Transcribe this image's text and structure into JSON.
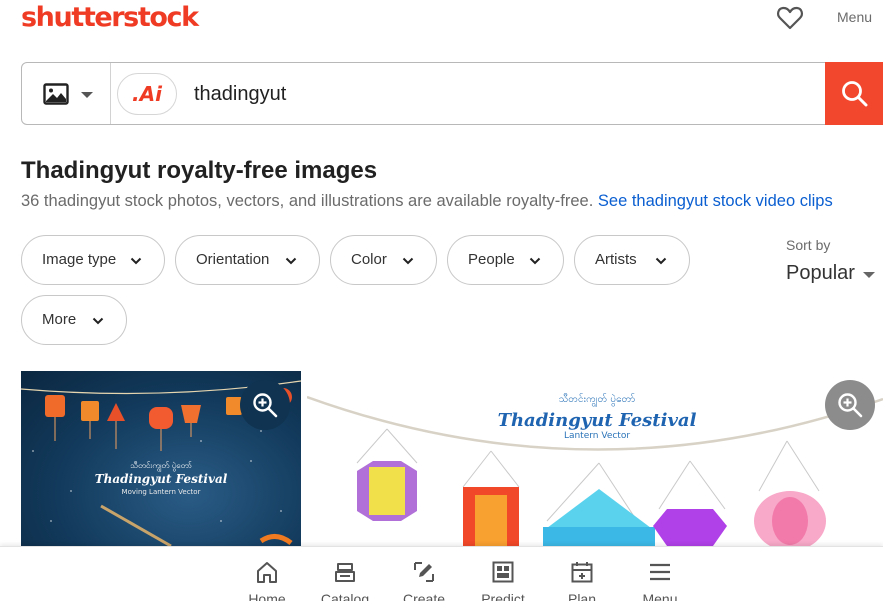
{
  "header": {
    "logo_text": "shutterstock",
    "menu_label": "Menu"
  },
  "search": {
    "ai_badge": ".Ai",
    "query": "thadingyut"
  },
  "results": {
    "title": "Thadingyut royalty-free images",
    "subtitle": "36 thadingyut stock photos, vectors, and illustrations are available royalty-free.",
    "video_link": "See thadingyut stock video clips"
  },
  "filters": [
    {
      "label": "Image type"
    },
    {
      "label": "Orientation"
    },
    {
      "label": "Color"
    },
    {
      "label": "People"
    },
    {
      "label": "Artists"
    },
    {
      "label": "More"
    }
  ],
  "sort": {
    "label": "Sort by",
    "value": "Popular"
  },
  "images": [
    {
      "burmese_text": "သီတင်းကျွတ် ပွဲတော်",
      "title": "Thadingyut Festival",
      "caption": "Moving Lantern Vector"
    },
    {
      "burmese_text": "သီတင်းကျွတ် ပွဲတော်",
      "title": "Thadingyut Festival",
      "caption": "Lantern Vector"
    }
  ],
  "bottom_nav": [
    {
      "label": "Home",
      "icon": "home-icon"
    },
    {
      "label": "Catalog",
      "icon": "catalog-icon"
    },
    {
      "label": "Create",
      "icon": "create-icon"
    },
    {
      "label": "Predict",
      "icon": "predict-icon"
    },
    {
      "label": "Plan",
      "icon": "plan-icon"
    },
    {
      "label": "Menu",
      "icon": "menu-icon"
    }
  ],
  "colors": {
    "brand": "#ef3b24",
    "search_button": "#f2472c",
    "link": "#0b5fd1"
  }
}
